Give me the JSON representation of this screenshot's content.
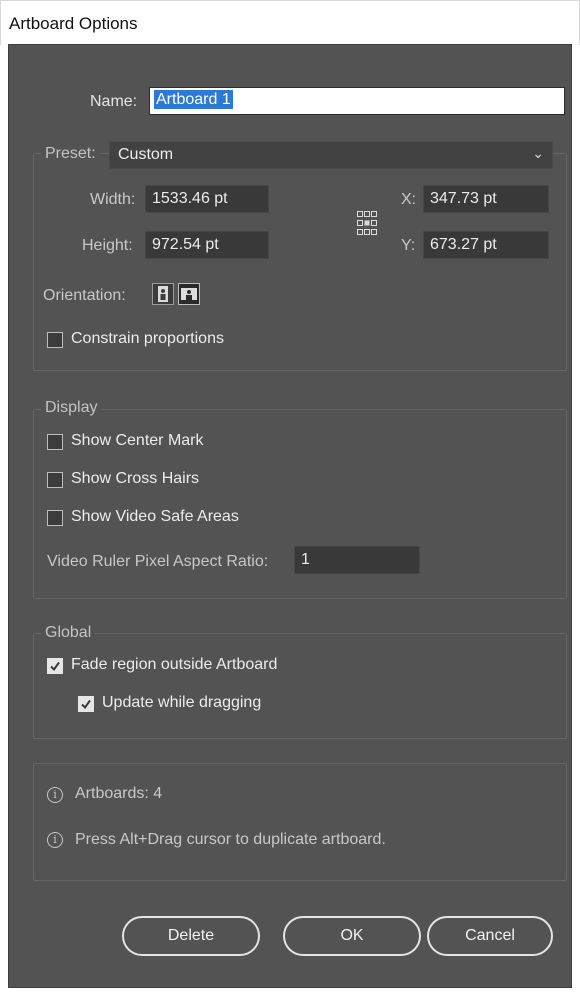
{
  "window": {
    "title": "Artboard Options"
  },
  "name": {
    "label": "Name:",
    "value": "Artboard 1"
  },
  "preset": {
    "label": "Preset:",
    "value": "Custom",
    "width_label": "Width:",
    "width_value": "1533.46 pt",
    "height_label": "Height:",
    "height_value": "972.54 pt",
    "x_label": "X:",
    "x_value": "347.73 pt",
    "y_label": "Y:",
    "y_value": "673.27 pt",
    "orientation_label": "Orientation:",
    "constrain_label": "Constrain proportions",
    "constrain_checked": false
  },
  "display": {
    "title": "Display",
    "center_mark_label": "Show Center Mark",
    "cross_hairs_label": "Show Cross Hairs",
    "video_safe_label": "Show Video Safe Areas",
    "pixel_ratio_label": "Video Ruler Pixel Aspect Ratio:",
    "pixel_ratio_value": "1"
  },
  "global": {
    "title": "Global",
    "fade_label": "Fade region outside Artboard",
    "fade_checked": true,
    "update_label": "Update while dragging",
    "update_checked": true
  },
  "info": {
    "artboards": "Artboards: 4",
    "hint": "Press Alt+Drag cursor to duplicate artboard."
  },
  "buttons": {
    "delete": "Delete",
    "ok": "OK",
    "cancel": "Cancel"
  },
  "icons": {
    "chevron": "chevron-down-icon",
    "reference_point": "reference-point-icon",
    "portrait": "portrait-orientation-icon",
    "landscape": "landscape-orientation-icon",
    "info": "info-icon",
    "check": "checkmark-icon"
  },
  "colors": {
    "dialog_bg": "#535353",
    "field_bg": "#393939",
    "selection": "#2d7ad6"
  }
}
